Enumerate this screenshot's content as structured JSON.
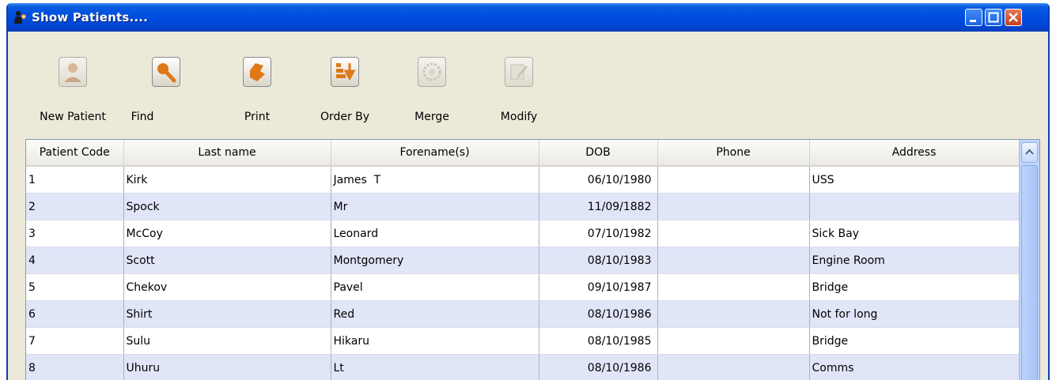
{
  "window": {
    "title": "Show Patients....",
    "icons": {
      "app": "patient-app-icon",
      "minimize": "minimize-icon",
      "maximize": "maximize-icon",
      "close": "close-icon"
    },
    "colors": {
      "titlebar": "#0050e0",
      "background": "#ece9d8",
      "row_alt": "#e1e5f8",
      "scrollbar": "#c0d6fa"
    }
  },
  "toolbar": {
    "new_patient": "New Patient",
    "find": "Find",
    "print": "Print",
    "order_by": "Order By",
    "merge": "Merge",
    "modify": "Modify",
    "disabled": [
      "Merge",
      "Modify"
    ]
  },
  "table": {
    "columns": [
      "Patient Code",
      "Last name",
      "Forename(s)",
      "DOB",
      "Phone",
      "Address"
    ],
    "rows": [
      {
        "code": "1",
        "last": "Kirk",
        "fore": "James  T",
        "dob": "06/10/1980",
        "phone": "",
        "address": "USS"
      },
      {
        "code": "2",
        "last": "Spock",
        "fore": "Mr",
        "dob": "11/09/1882",
        "phone": "",
        "address": ""
      },
      {
        "code": "3",
        "last": "McCoy",
        "fore": "Leonard",
        "dob": "07/10/1982",
        "phone": "",
        "address": "Sick Bay"
      },
      {
        "code": "4",
        "last": "Scott",
        "fore": "Montgomery",
        "dob": "08/10/1983",
        "phone": "",
        "address": "Engine Room"
      },
      {
        "code": "5",
        "last": "Chekov",
        "fore": "Pavel",
        "dob": "09/10/1987",
        "phone": "",
        "address": "Bridge"
      },
      {
        "code": "6",
        "last": "Shirt",
        "fore": "Red",
        "dob": "08/10/1986",
        "phone": "",
        "address": "Not for long"
      },
      {
        "code": "7",
        "last": "Sulu",
        "fore": "Hikaru",
        "dob": "08/10/1985",
        "phone": "",
        "address": "Bridge"
      },
      {
        "code": "8",
        "last": "Uhuru",
        "fore": "Lt",
        "dob": "08/10/1986",
        "phone": "",
        "address": "Comms"
      }
    ]
  }
}
